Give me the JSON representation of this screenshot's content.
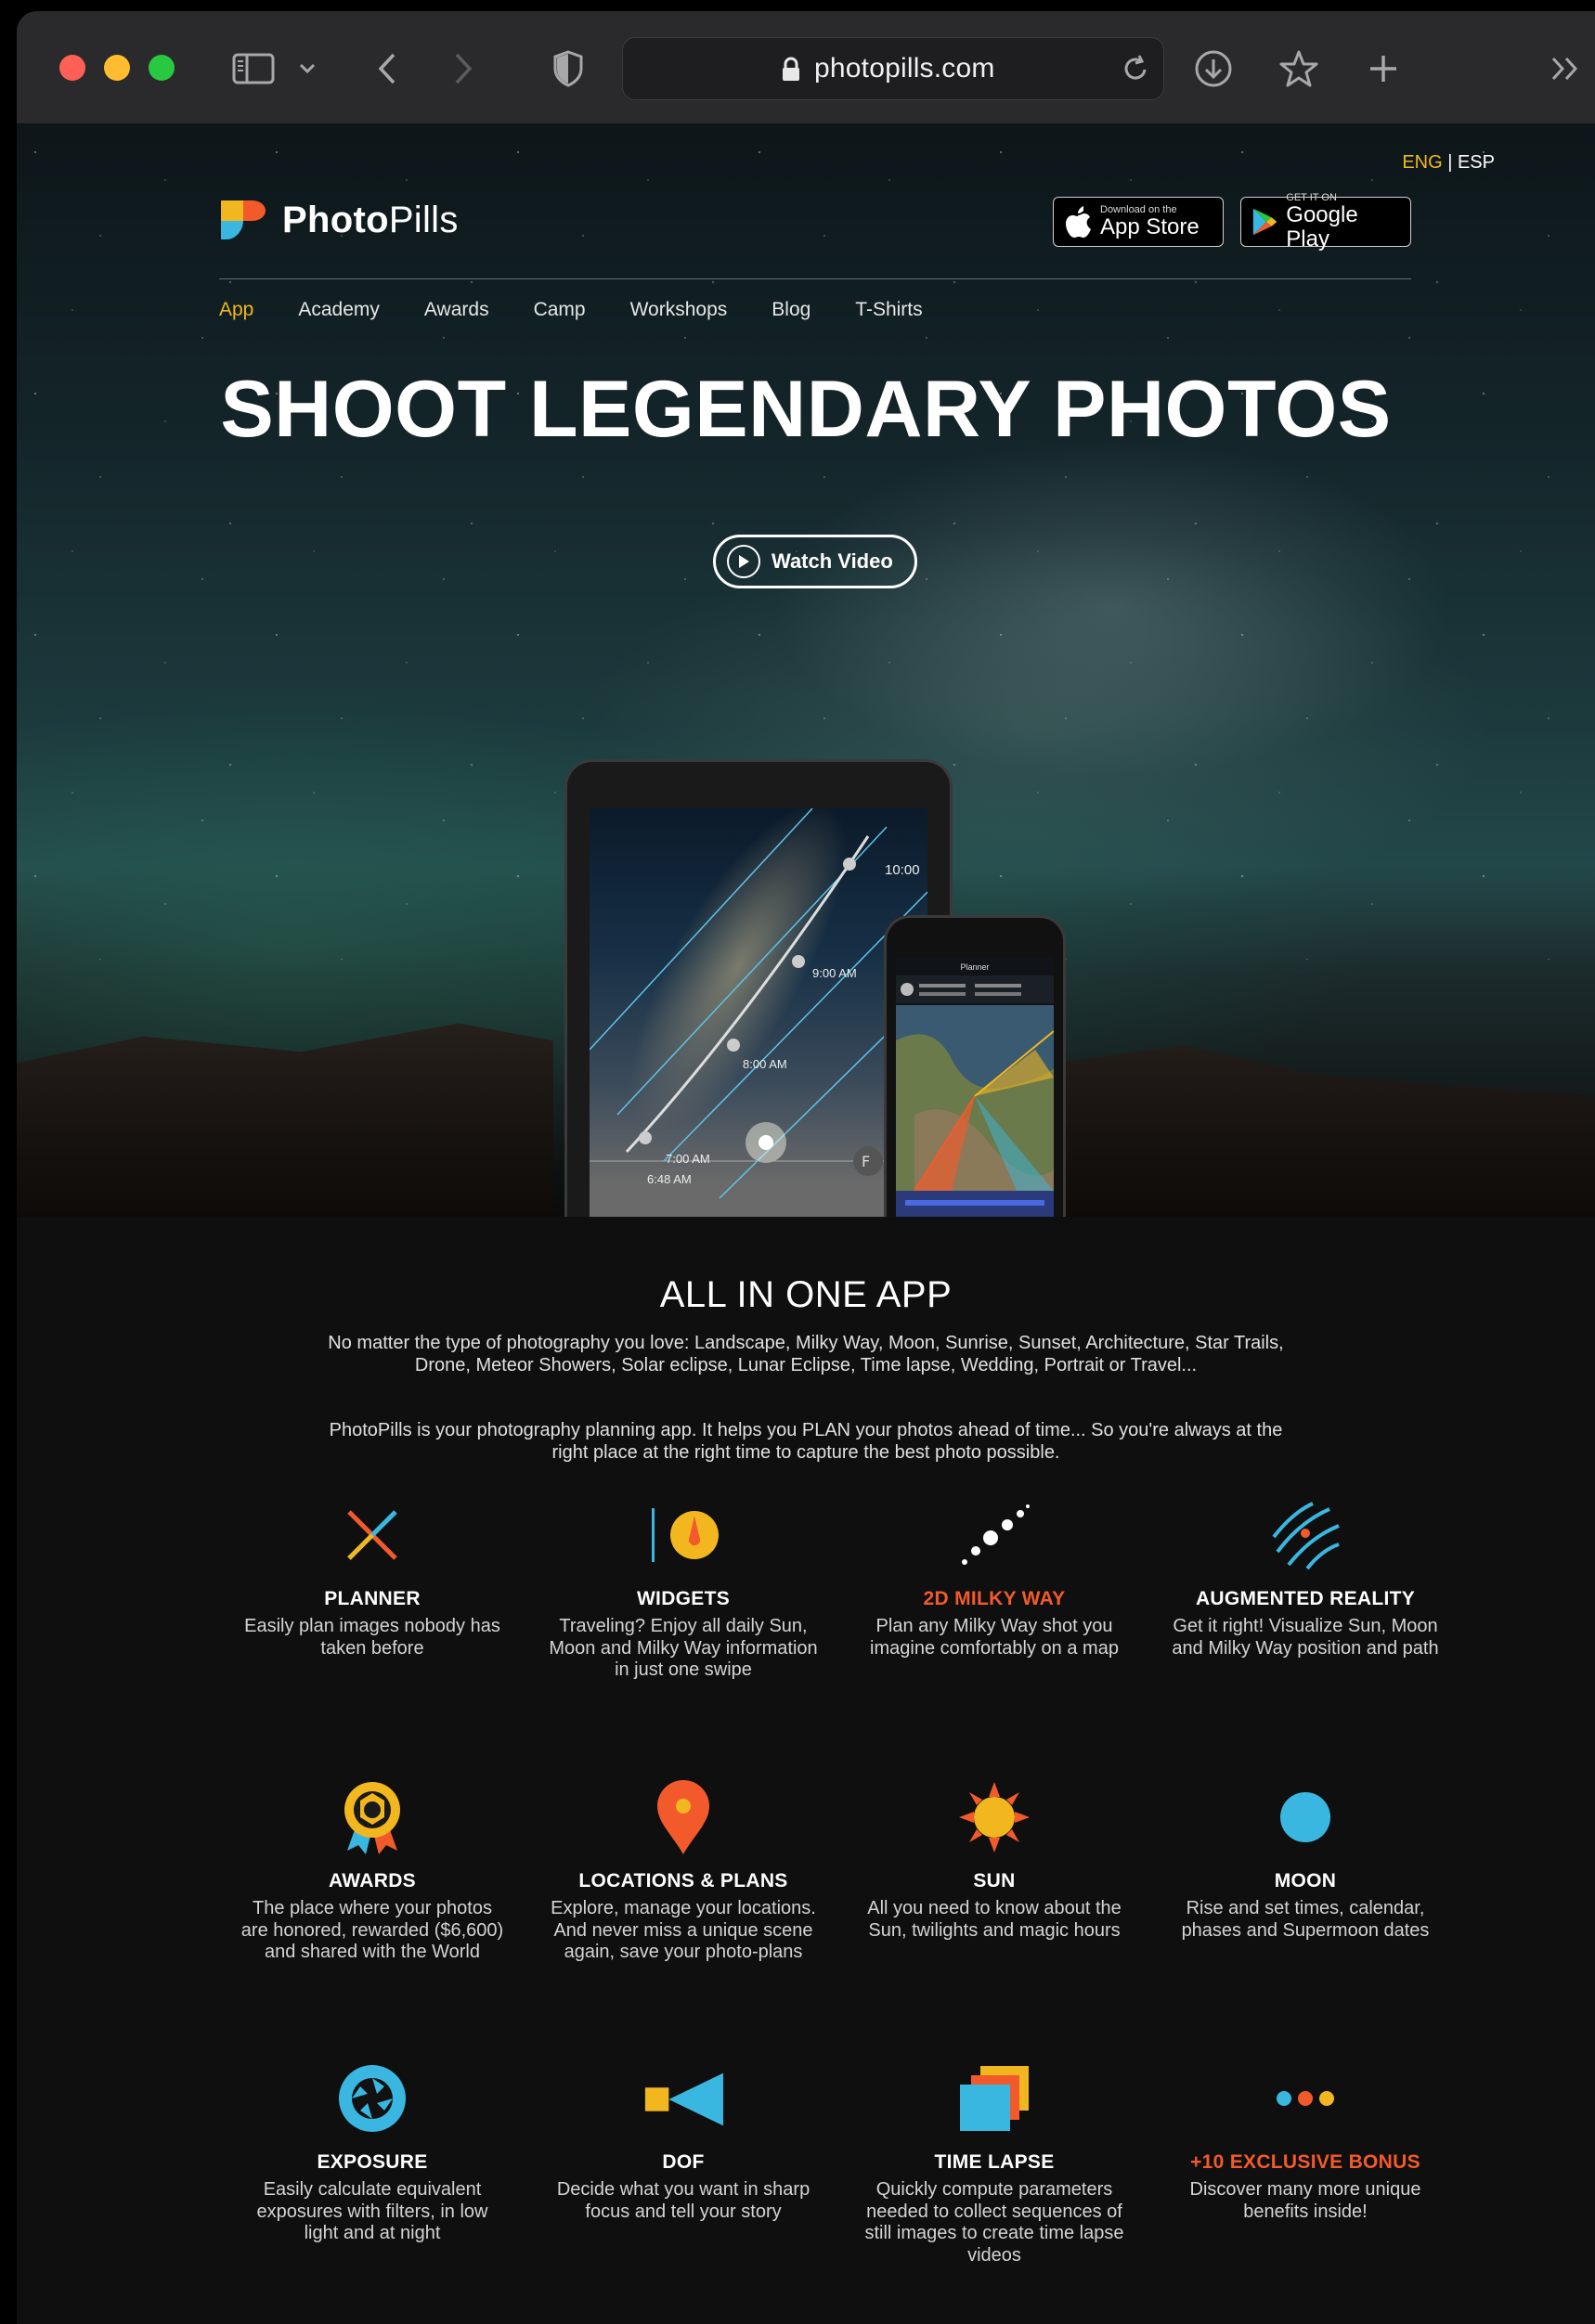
{
  "browser": {
    "url": "photopills.com"
  },
  "header": {
    "lang_eng": "ENG",
    "lang_sep": " | ",
    "lang_esp": "ESP",
    "logo_bold": "Photo",
    "logo_light": "Pills",
    "app_store_small": "Download on the",
    "app_store_big": "App Store",
    "google_small": "GET IT ON",
    "google_big": "Google Play"
  },
  "nav": {
    "items": [
      "App",
      "Academy",
      "Awards",
      "Camp",
      "Workshops",
      "Blog",
      "T-Shirts"
    ]
  },
  "hero": {
    "title": "SHOOT LEGENDARY PHOTOS",
    "watch_label": "Watch Video",
    "tablet_times": [
      "10:00",
      "9:00 AM",
      "8:00 AM",
      "7:00 AM",
      "6:48 AM"
    ],
    "phone_title": "Planner"
  },
  "intro": {
    "title": "ALL IN ONE APP",
    "p1": "No matter the type of photography you love: Landscape, Milky Way, Moon, Sunrise, Sunset, Architecture, Star Trails, Drone, Meteor Showers, Solar eclipse, Lunar Eclipse, Time lapse, Wedding, Portrait or Travel...",
    "p2": "PhotoPills is your photography planning app. It helps you PLAN your photos ahead of time... So you're always at the right place at the right time to capture the best photo possible."
  },
  "features": [
    {
      "title": "PLANNER",
      "desc": "Easily plan images nobody has taken before",
      "icon": "planner-icon"
    },
    {
      "title": "WIDGETS",
      "desc": "Traveling? Enjoy all daily Sun, Moon and Milky Way information in just one swipe",
      "icon": "widgets-icon"
    },
    {
      "title": "2D MILKY WAY",
      "desc": "Plan any Milky Way shot you imagine comfortably on a map",
      "icon": "milky-way-icon"
    },
    {
      "title": "AUGMENTED REALITY",
      "desc": "Get it right! Visualize Sun, Moon and Milky Way position and path",
      "icon": "augmented-reality-icon"
    },
    {
      "title": "AWARDS",
      "desc": "The place where your photos are honored, rewarded ($6,600) and shared with the World",
      "icon": "awards-icon"
    },
    {
      "title": "LOCATIONS & PLANS",
      "desc": "Explore, manage your locations. And never miss a unique scene again, save your photo-plans",
      "icon": "location-pin-icon"
    },
    {
      "title": "SUN",
      "desc": "All you need to know about the Sun, twilights and magic hours",
      "icon": "sun-icon"
    },
    {
      "title": "MOON",
      "desc": "Rise and set times, calendar, phases and Supermoon dates",
      "icon": "moon-icon"
    },
    {
      "title": "EXPOSURE",
      "desc": "Easily calculate equivalent exposures with filters, in low light and at night",
      "icon": "aperture-icon"
    },
    {
      "title": "DOF",
      "desc": "Decide what you want in sharp focus and tell your story",
      "icon": "dof-icon"
    },
    {
      "title": "TIME LAPSE",
      "desc": "Quickly compute parameters needed to collect sequences of still images to create time lapse videos",
      "icon": "time-lapse-icon"
    },
    {
      "title": "+10 EXCLUSIVE BONUS",
      "desc": "Discover many more unique benefits inside!",
      "icon": "more-dots-icon"
    }
  ],
  "colors": {
    "accent_yellow": "#f2b71f",
    "accent_orange": "#f25a2b",
    "accent_blue": "#3ab7e0"
  }
}
